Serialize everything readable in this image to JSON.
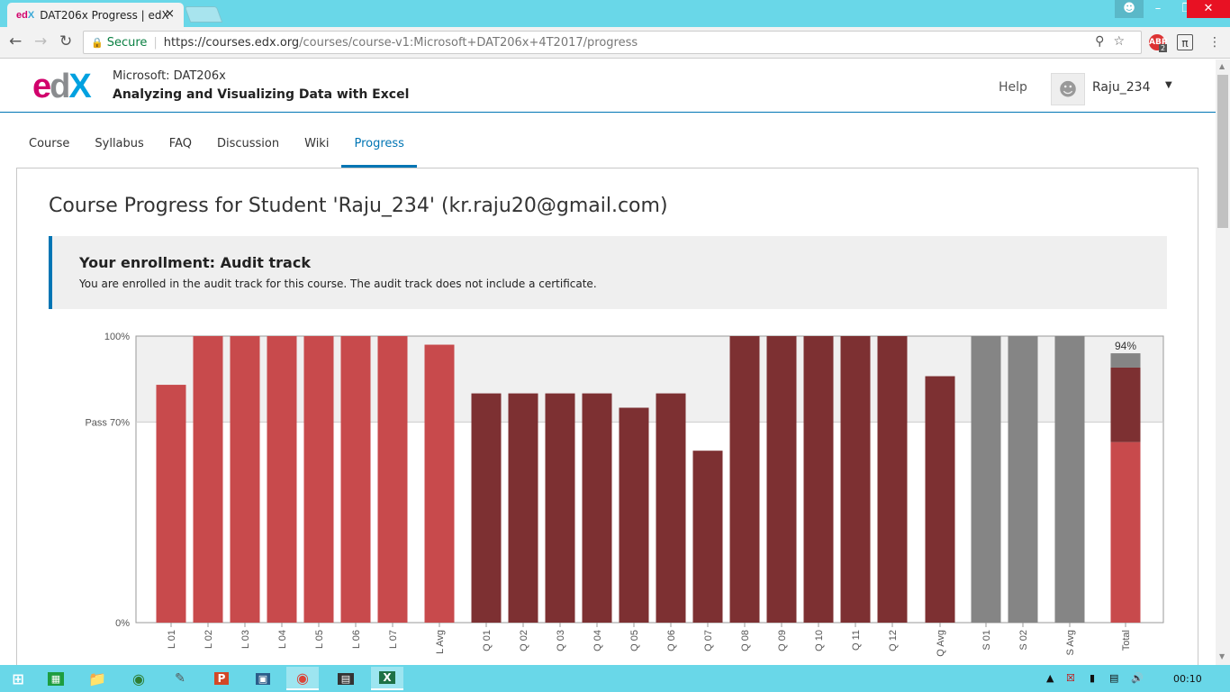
{
  "browser": {
    "tab_favicon_e": "ed",
    "tab_favicon_x": "X",
    "tab_title": "DAT206x Progress | edX",
    "tab_close": "×",
    "secure_label": "Secure",
    "url_host": "https://courses.edx.org",
    "url_path": "/courses/course-v1:Microsoft+DAT206x+4T2017/progress",
    "abp_count": "2"
  },
  "header": {
    "course_org": "Microsoft: DAT206x",
    "course_name": "Analyzing and Visualizing Data with Excel",
    "help": "Help",
    "username": "Raju_234"
  },
  "course_tabs": [
    "Course",
    "Syllabus",
    "FAQ",
    "Discussion",
    "Wiki",
    "Progress"
  ],
  "active_tab": "Progress",
  "page": {
    "title": "Course Progress for Student 'Raju_234' (kr.raju20@gmail.com)",
    "enroll_title": "Your enrollment: Audit track",
    "enroll_msg": "You are enrolled in the audit track for this course. The audit track does not include a certificate."
  },
  "chart_data": {
    "type": "bar",
    "y_ticks": [
      "100%",
      "Pass 70%",
      "0%"
    ],
    "ylim": [
      0,
      100
    ],
    "pass_line": 70,
    "categories": [
      "L 01",
      "L 02",
      "L 03",
      "L 04",
      "L 05",
      "L 06",
      "L 07",
      "L Avg",
      "Q 01",
      "Q 02",
      "Q 03",
      "Q 04",
      "Q 05",
      "Q 06",
      "Q 07",
      "Q 08",
      "Q 09",
      "Q 10",
      "Q 11",
      "Q 12",
      "Q Avg",
      "S 01",
      "S 02",
      "S Avg",
      "Total"
    ],
    "values": [
      83,
      100,
      100,
      100,
      100,
      100,
      100,
      97,
      80,
      80,
      80,
      80,
      75,
      80,
      60,
      100,
      100,
      100,
      100,
      100,
      86,
      100,
      100,
      100,
      94
    ],
    "groups": [
      "lab",
      "lab",
      "lab",
      "lab",
      "lab",
      "lab",
      "lab",
      "lab",
      "quiz",
      "quiz",
      "quiz",
      "quiz",
      "quiz",
      "quiz",
      "quiz",
      "quiz",
      "quiz",
      "quiz",
      "quiz",
      "quiz",
      "quiz",
      "survey",
      "survey",
      "survey",
      "total"
    ],
    "total_breakdown": [
      63,
      26,
      5
    ],
    "total_label": "94%",
    "colors": {
      "lab": "#c84a4c",
      "quiz": "#7d3032",
      "survey": "#858585",
      "pass_band": "#f0f0f0"
    }
  },
  "taskbar": {
    "clock": "00:10"
  }
}
